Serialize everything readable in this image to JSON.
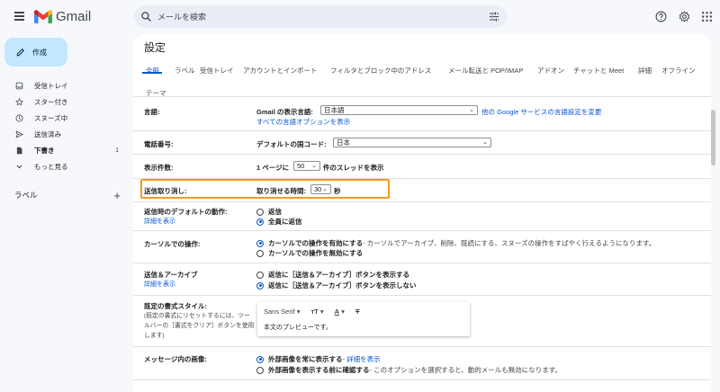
{
  "app": {
    "name": "Gmail",
    "brand_colors": {
      "red": "#ea4335",
      "blue": "#4285f4",
      "green": "#34a853",
      "yellow": "#fbbc04"
    }
  },
  "search": {
    "placeholder": "メールを検索"
  },
  "sidebar": {
    "compose_label": "作成",
    "items": [
      {
        "label": "受信トレイ",
        "icon": "inbox-icon"
      },
      {
        "label": "スター付き",
        "icon": "star-icon"
      },
      {
        "label": "スヌーズ中",
        "icon": "clock-icon"
      },
      {
        "label": "送信済み",
        "icon": "send-icon"
      },
      {
        "label": "下書き",
        "icon": "draft-icon",
        "count": "1"
      },
      {
        "label": "もっと見る",
        "icon": "chevron-down-icon"
      }
    ],
    "labels_heading": "ラベル"
  },
  "settings": {
    "title": "設定",
    "tabs": [
      "全般",
      "ラベル",
      "受信トレイ",
      "アカウントとインポート",
      "フィルタとブロック中のアドレス",
      "メール転送と POP/IMAP",
      "アドオン",
      "チャットと Meet",
      "詳細",
      "オフライン",
      "テーマ"
    ],
    "active_tab": "全般",
    "language": {
      "label": "言語:",
      "prefix": "Gmail の表示言語:",
      "value": "日本語",
      "link1": "他の Google サービスの言語設定を変更",
      "link2": "すべての言語オプションを表示"
    },
    "phone": {
      "label": "電話番号:",
      "prefix": "デフォルトの国コード:",
      "value": "日本"
    },
    "page_size": {
      "label": "表示件数:",
      "prefix": "1 ページに",
      "value": "50",
      "suffix": "件のスレッドを表示"
    },
    "undo_send": {
      "label": "送信取り消し:",
      "prefix": "取り消せる時間:",
      "value": "30",
      "suffix": "秒",
      "highlight_color": "#f29b1f"
    },
    "reply_default": {
      "label": "返信時のデフォルトの動作:",
      "link": "詳細を表示",
      "opt1": "返信",
      "opt2": "全員に返信"
    },
    "cursor": {
      "label": "カーソルでの操作:",
      "opt1_bold": "カーソルでの操作を有効にする",
      "opt1_desc": " - カーソルでアーカイブ、削除、既読にする、スヌーズの操作をすばやく行えるようになります。",
      "opt2_bold": "カーソルでの操作を無効にする"
    },
    "send_archive": {
      "label": "送信＆アーカイブ",
      "link": "詳細を表示",
      "opt1": "返信に［送信＆アーカイブ］ボタンを表示する",
      "opt2": "返信に［送信＆アーカイブ］ボタンを表示しない"
    },
    "text_style": {
      "label": "既定の書式スタイル:",
      "note_line1": "(既定の書式にリセットするには、ツー",
      "note_line2": "ルバーの［書式をクリア］ボタンを使用",
      "note_line3": "します)",
      "font": "Sans Serif",
      "preview": "本文のプレビューです。"
    },
    "images": {
      "label": "メッセージ内の画像:",
      "opt1_bold": "外部画像を常に表示する",
      "opt1_link": " - 詳細を表示",
      "opt2_bold": "外部画像を表示する前に確認する",
      "opt2_desc": " - このオプションを選択すると、動的メールも無効になります。"
    }
  }
}
